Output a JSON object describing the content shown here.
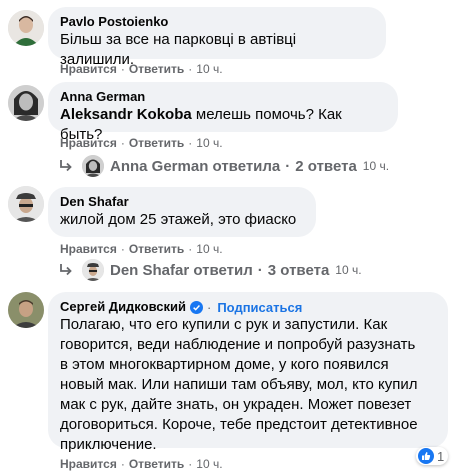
{
  "comments": [
    {
      "author": "Pavlo Postoienko",
      "text": "Більш за все на парковці в автівці залишили.",
      "actions": {
        "like": "Нравится",
        "reply": "Ответить",
        "time": "10 ч."
      }
    },
    {
      "author": "Anna German",
      "mention": "Aleksandr Kokoba",
      "text": " мелешь помочь? Как быть?",
      "actions": {
        "like": "Нравится",
        "reply": "Ответить",
        "time": "10 ч."
      },
      "replies": {
        "name": "Anna German",
        "verb": "ответила",
        "count": "2 ответа",
        "time": "10 ч."
      }
    },
    {
      "author": "Den Shafar",
      "text": "жилой дом 25 этажей, это фиаско",
      "actions": {
        "like": "Нравится",
        "reply": "Ответить",
        "time": "10 ч."
      },
      "replies": {
        "name": "Den Shafar",
        "verb": "ответил",
        "count": "3 ответа",
        "time": "10 ч."
      }
    },
    {
      "author": "Сергей Дидковский",
      "subscribe": "Подписаться",
      "lines": [
        "Полагаю, что его купили с рук и запустили. Как",
        "говорится, веди наблюдение и попробуй разузнать",
        "в этом многоквартирном доме, у кого появился",
        "новый мак. Или напиши там объяву, мол, кто купил",
        "мак с рук, дайте знать, он украден. Может повезет",
        "договориться. Короче, тебе предстоит детективное",
        "приключение."
      ],
      "reaction_count": "1",
      "actions": {
        "like": "Нравится",
        "reply": "Ответить",
        "time": "10 ч."
      }
    }
  ],
  "separator": "·",
  "colors": {
    "bubble": "#f0f2f5",
    "meta": "#65676b",
    "link": "#1b74e4",
    "like": "#1877f2"
  },
  "icons": [
    "reply-arrow-icon",
    "verified-badge-icon",
    "like-reaction-icon"
  ]
}
